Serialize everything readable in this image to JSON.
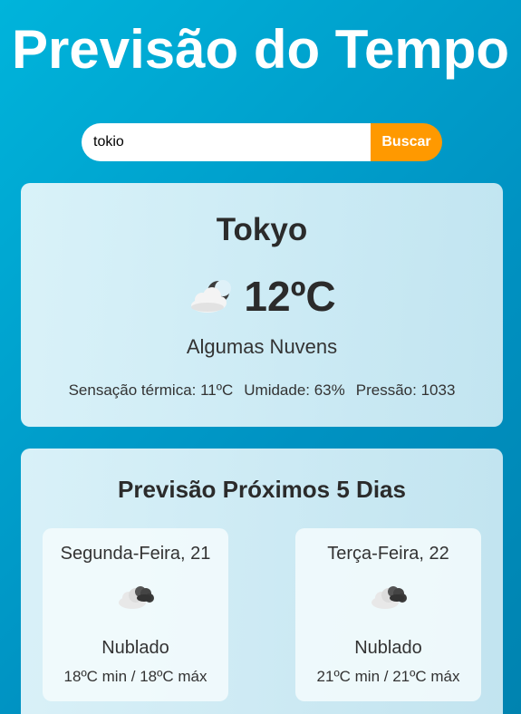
{
  "header": {
    "title": "Previsão do Tempo"
  },
  "search": {
    "value": "tokio",
    "button_label": "Buscar"
  },
  "current": {
    "city": "Tokyo",
    "temperature": "12ºC",
    "description": "Algumas Nuvens",
    "icon": "night-cloud-icon",
    "details": {
      "feels_like": "Sensação térmica: 11ºC",
      "humidity": "Umidade: 63%",
      "pressure": "Pressão: 1033"
    }
  },
  "forecast": {
    "title": "Previsão Próximos 5 Dias",
    "days": [
      {
        "day": "Segunda-Feira, 21",
        "icon": "dark-clouds-icon",
        "description": "Nublado",
        "temps": "18ºC min / 18ºC máx"
      },
      {
        "day": "Terça-Feira, 22",
        "icon": "dark-clouds-icon",
        "description": "Nublado",
        "temps": "21ºC min / 21ºC máx"
      }
    ]
  },
  "colors": {
    "background_start": "#00b4db",
    "background_end": "#0083b0",
    "button": "#ff9900",
    "text": "#333333"
  }
}
